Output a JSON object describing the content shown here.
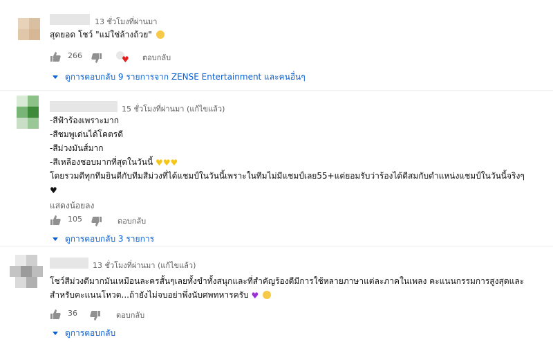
{
  "comments": [
    {
      "time": "13 ชั่วโมงที่ผ่านมา",
      "lines": [
        "สุดยอด โชว์ \"แม่ใช่ล้างถ้วย\""
      ],
      "likes": "266",
      "reply_label": "ตอบกลับ",
      "replies_label": "ดูการตอบกลับ 9 รายการจาก ZENSE Entertainment และคนอื่นๆ",
      "avatar_colors": [
        "#e3d2b8",
        "#d7bfa0",
        "#e8cfb5",
        "#dfc2a4"
      ]
    },
    {
      "time": "15 ชั่วโมงที่ผ่านมา (แก้ไขแล้ว)",
      "lines": [
        "-สีฟ้าร้องเพราะมาก",
        "-สีชมพูเด่นได้โคตรดี",
        "-สีม่วงมันส์มาก",
        "-สีเหลืองชอบมากที่สุดในวันนี้",
        "โดยรวมดีทุกทีมยินดีกับทีมสีม่วงที่ได้แชมป์ในวันนี้เพราะในทีมไม่มีแชมป์เลย55+แต่ยอมรับว่าร้องได้ดีสมกับตำแหน่งแชมป์ในวันนี้จริงๆ"
      ],
      "show_less": "แสดงน้อยลง",
      "likes": "105",
      "reply_label": "ตอบกลับ",
      "replies_label": "ดูการตอบกลับ 3 รายการ",
      "avatar_colors": [
        "#c4dcc0",
        "#5b9a58",
        "#a9cfa4",
        "#3f8a3d"
      ]
    },
    {
      "time": "13 ชั่วโมงที่ผ่านมา (แก้ไขแล้ว)",
      "lines": [
        "โชว์สีม่วงดีมากมันเหมือนละครสั้นๆเลยทั้งขำทั้งสนุกและที่สำคัญร้องดีมีการใช้หลายภาษาแต่ละภาคในเพลง คะแนนกรรมการสูงสุดและ",
        "สำหรับคะแนนโหวต...ถ้ายังไม่จบอย่าพึ่งนับศพทหารครับ"
      ],
      "likes": "36",
      "reply_label": "ตอบกลับ",
      "replies_label": "ดูการตอบกลับ",
      "avatar_colors": [
        "#dcdcdc",
        "#a9a9a9",
        "#c6c6c6",
        "#8f8f8f"
      ]
    }
  ],
  "icons": {
    "like": "thumb-up-icon",
    "dislike": "thumb-down-icon",
    "creator_heart": "creator-heart-icon",
    "emoji_grin": "grinning-emoji",
    "emoji_yellow_heart": "yellow-heart-emoji",
    "emoji_black_heart": "black-heart-emoji",
    "emoji_purple_heart": "purple-heart-emoji",
    "emoji_smile_hearts": "smiling-hearts-emoji"
  },
  "colors": {
    "link": "#065fd4",
    "meta": "#606060",
    "text": "#0f0f0f"
  }
}
